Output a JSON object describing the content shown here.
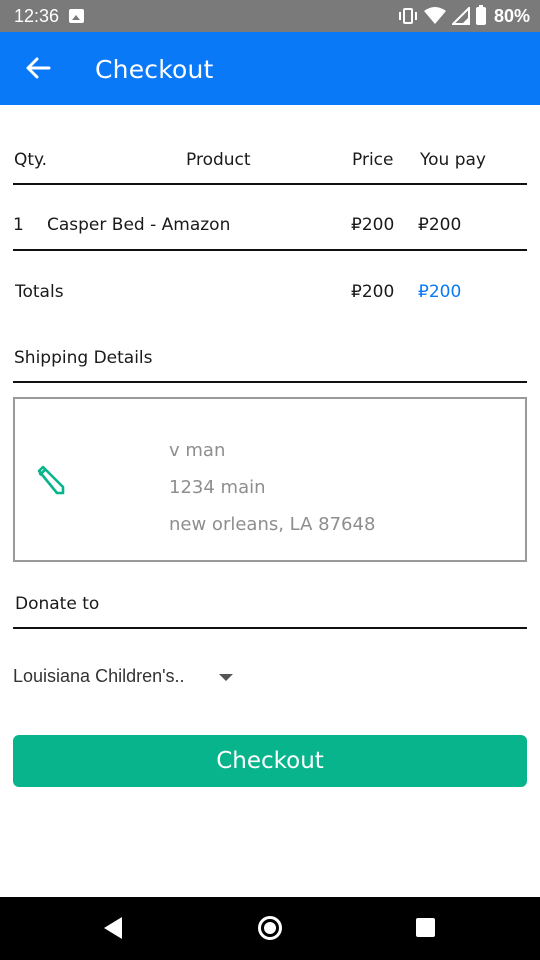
{
  "status_bar": {
    "time": "12:36",
    "battery": "80%",
    "icons": [
      "image-icon",
      "vibrate-icon",
      "wifi-icon",
      "signal-icon",
      "battery-icon"
    ]
  },
  "app_bar": {
    "title": "Checkout",
    "back_icon": "arrow-left-icon",
    "color": "#0a79f8"
  },
  "table": {
    "headers": {
      "qty": "Qty.",
      "product": "Product",
      "price": "Price",
      "you_pay": "You pay"
    },
    "rows": [
      {
        "qty": "1",
        "product": "Casper Bed - Amazon",
        "price": "₽200",
        "you_pay": "₽200"
      }
    ],
    "totals": {
      "label": "Totals",
      "price": "₽200",
      "you_pay": "₽200"
    }
  },
  "shipping": {
    "heading": "Shipping Details",
    "edit_icon": "pencil-icon",
    "name": "v man",
    "street": "1234 main",
    "city_line": "new orleans, LA 87648"
  },
  "donate": {
    "heading": "Donate to",
    "selected": "Louisiana Children's.."
  },
  "checkout_button": {
    "label": "Checkout",
    "color": "#07b48c"
  },
  "nav_bar": {
    "icons": [
      "back-triangle-icon",
      "home-circle-icon",
      "recents-square-icon"
    ]
  }
}
